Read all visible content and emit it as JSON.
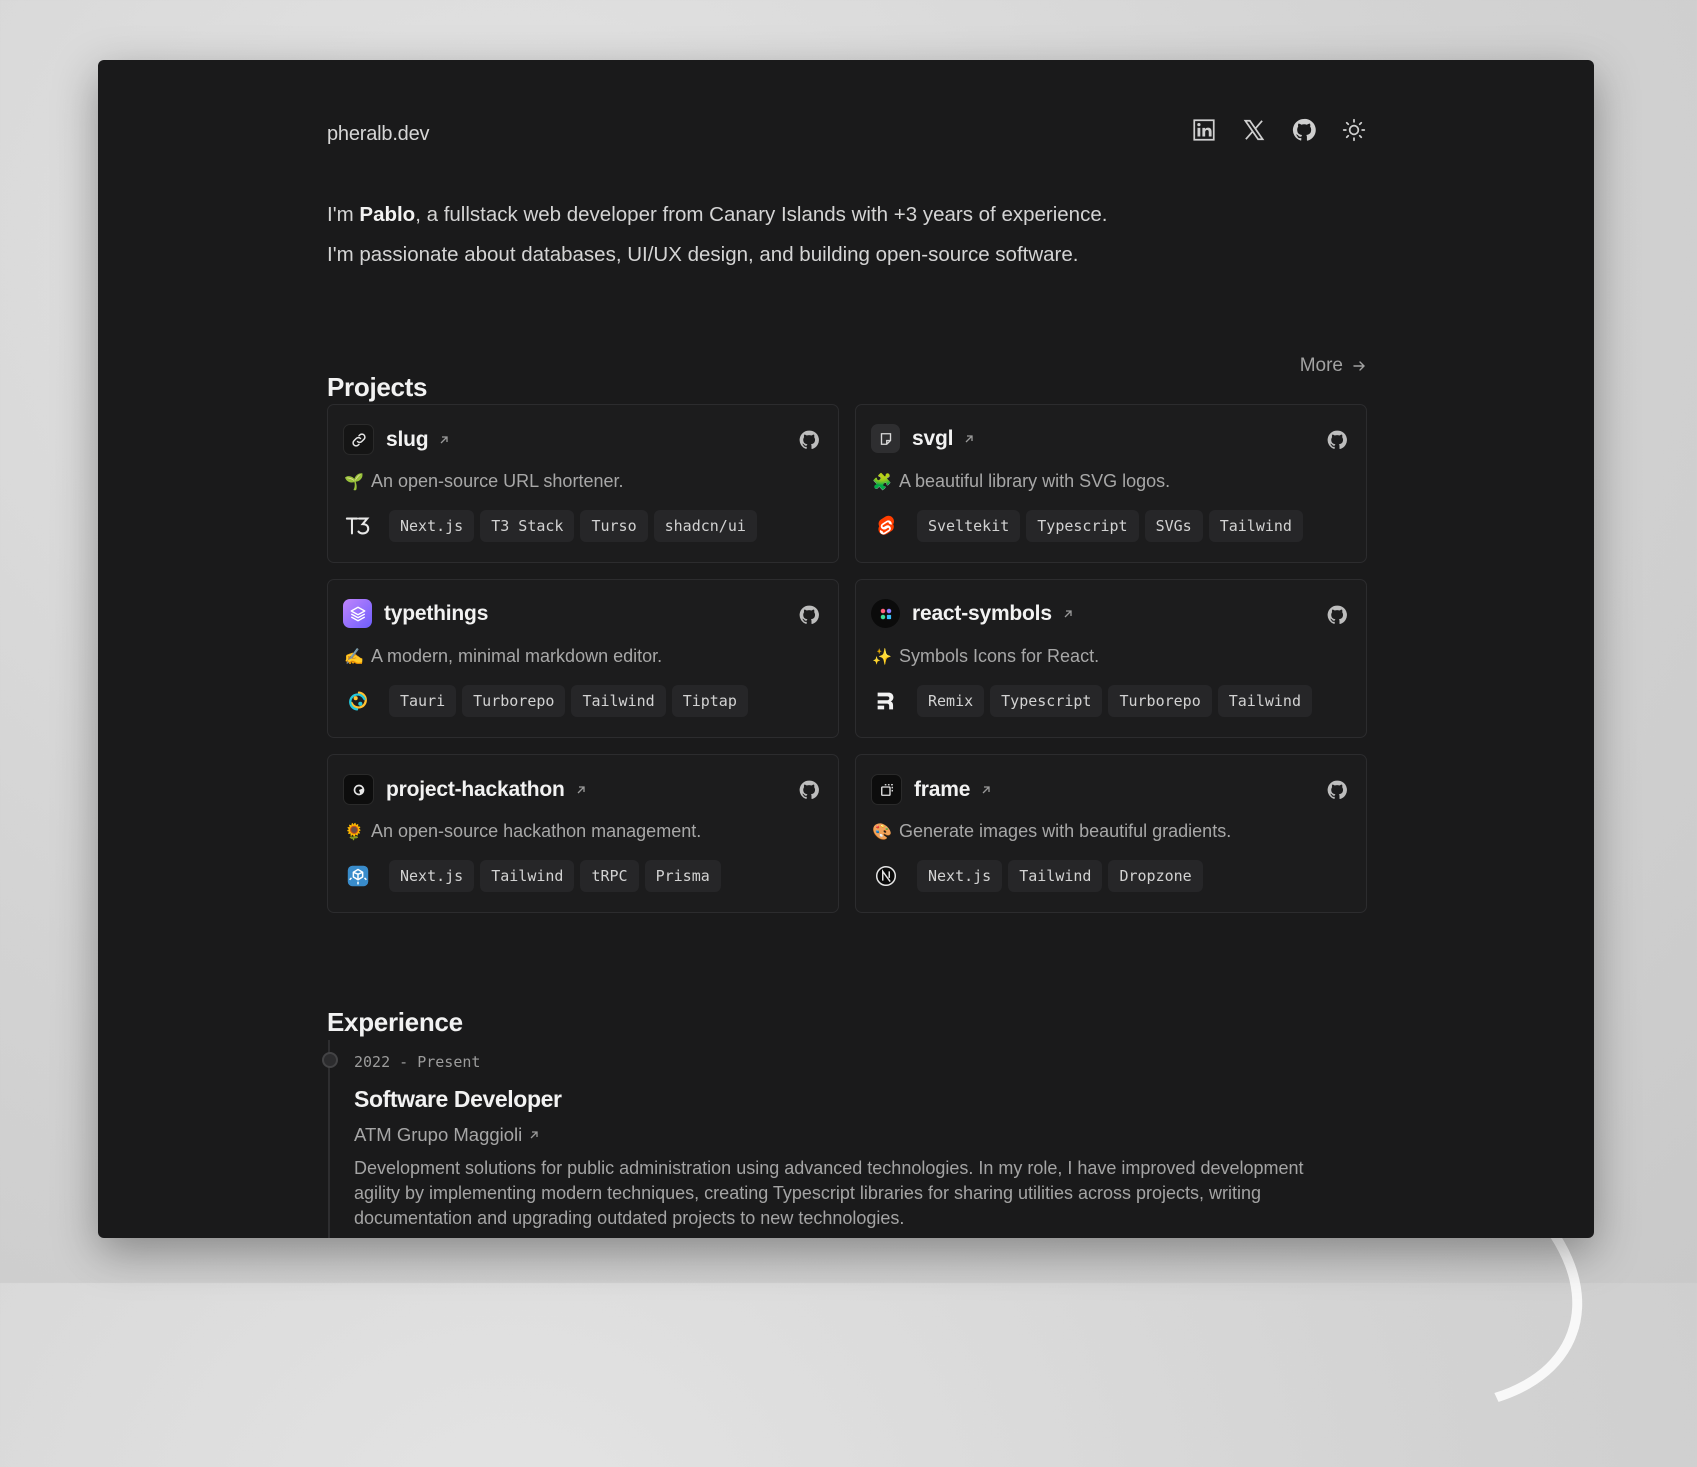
{
  "site": {
    "title": "pheralb.dev"
  },
  "header": {
    "icons": [
      "linkedin-icon",
      "x-icon",
      "github-icon",
      "sun-icon"
    ]
  },
  "intro": {
    "line1_prefix": "I'm ",
    "name": "Pablo",
    "line1_suffix": ", a fullstack web developer from Canary Islands with +3 years of experience.",
    "line2": "I'm passionate about databases, UI/UX design, and building open-source software."
  },
  "projects": {
    "title": "Projects",
    "more_label": "More",
    "items": [
      {
        "name": "slug",
        "emoji": "🌱",
        "description": "An open-source URL shortener.",
        "stack_icon": "t3-icon",
        "tags": [
          "Next.js",
          "T3 Stack",
          "Turso",
          "shadcn/ui"
        ],
        "external": true
      },
      {
        "name": "svgl",
        "emoji": "🧩",
        "description": "A beautiful library with SVG logos.",
        "stack_icon": "svelte-icon",
        "tags": [
          "Sveltekit",
          "Typescript",
          "SVGs",
          "Tailwind"
        ],
        "external": true
      },
      {
        "name": "typethings",
        "emoji": "✍️",
        "description": "A modern, minimal markdown editor.",
        "stack_icon": "tauri-icon",
        "tags": [
          "Tauri",
          "Turborepo",
          "Tailwind",
          "Tiptap"
        ],
        "external": false
      },
      {
        "name": "react-symbols",
        "emoji": "✨",
        "description": "Symbols Icons for React.",
        "stack_icon": "remix-icon",
        "tags": [
          "Remix",
          "Typescript",
          "Turborepo",
          "Tailwind"
        ],
        "external": true
      },
      {
        "name": "project-hackathon",
        "emoji": "🌻",
        "description": "An open-source hackathon management.",
        "stack_icon": "trpc-icon",
        "tags": [
          "Next.js",
          "Tailwind",
          "tRPC",
          "Prisma"
        ],
        "external": true
      },
      {
        "name": "frame",
        "emoji": "🎨",
        "description": "Generate images with beautiful gradients.",
        "stack_icon": "nextjs-icon",
        "tags": [
          "Next.js",
          "Tailwind",
          "Dropzone"
        ],
        "external": true
      }
    ]
  },
  "experience": {
    "title": "Experience",
    "items": [
      {
        "date": "2022 - Present",
        "role": "Software Developer",
        "company": "ATM Grupo Maggioli",
        "description": "Development solutions for public administration using advanced technologies. In my role, I have improved development agility by implementing modern techniques, creating Typescript libraries for sharing utilities across projects, writing documentation and upgrading outdated projects to new technologies."
      }
    ]
  },
  "colors": {
    "window_bg": "#1a1a1b",
    "card_border": "#2c2c2e",
    "tag_bg": "#262628",
    "text_primary": "#f2f2f2",
    "text_muted": "#a7a7a7"
  }
}
